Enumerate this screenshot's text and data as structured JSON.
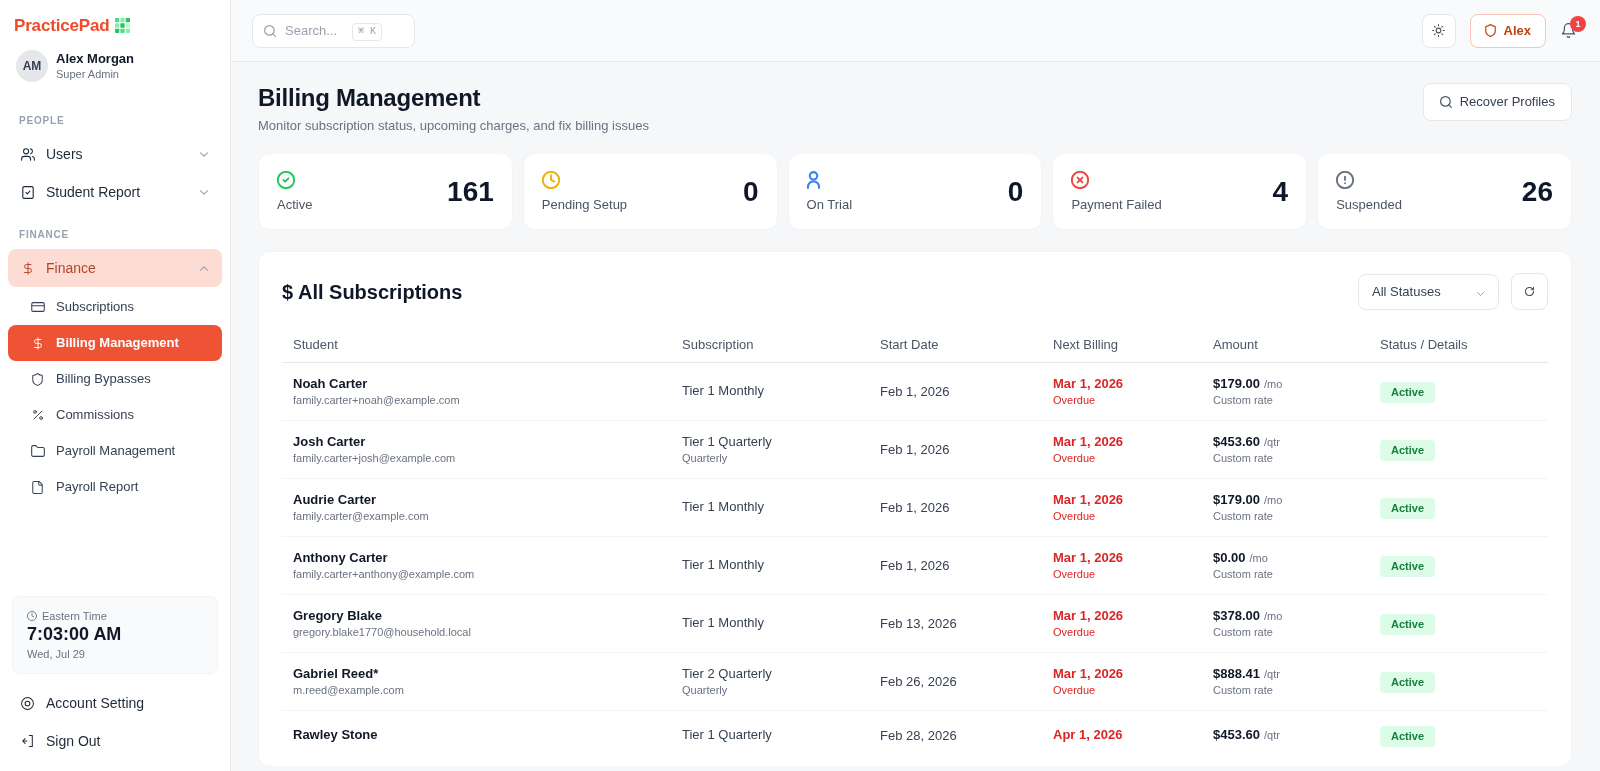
{
  "sidebar": {
    "logo": "PracticePad",
    "user": {
      "initials": "AM",
      "name": "Alex Morgan",
      "role": "Super Admin"
    },
    "sections": [
      {
        "heading": "PEOPLE",
        "items": [
          {
            "label": "Users",
            "selected": false,
            "expanded": false
          },
          {
            "label": "Student Report",
            "selected": false,
            "expanded": false
          }
        ]
      },
      {
        "heading": "FINANCE",
        "items": [
          {
            "label": "Finance",
            "selected": true,
            "expanded": true,
            "children": [
              {
                "label": "Subscriptions",
                "selected": false
              },
              {
                "label": "Billing Management",
                "selected": true
              },
              {
                "label": "Billing Bypasses",
                "selected": false
              },
              {
                "label": "Commissions",
                "selected": false
              },
              {
                "label": "Payroll Management",
                "selected": false
              },
              {
                "label": "Payroll Report",
                "selected": false
              }
            ]
          }
        ]
      }
    ],
    "clock": {
      "zone": "Eastern Time",
      "time": "7:03:00 AM",
      "date": "Wed, Jul 29"
    },
    "footer_items": [
      {
        "label": "Account Setting"
      },
      {
        "label": "Sign Out"
      }
    ]
  },
  "topbar": {
    "search": {
      "placeholder": "Search...",
      "shortcut": "⌘ K"
    },
    "account_button": "Alex",
    "notification_badge": "1"
  },
  "header": {
    "title": "Billing Management",
    "subtitle": "Monitor subscription status, upcoming charges, and fix billing issues",
    "action": "Recover Profiles"
  },
  "stats": [
    {
      "label": "Active",
      "value": "161",
      "color": "#22c55e"
    },
    {
      "label": "Pending Setup",
      "value": "0",
      "color": "#eab308"
    },
    {
      "label": "On Trial",
      "value": "0",
      "color": "#3b82f6"
    },
    {
      "label": "Payment Failed",
      "value": "4",
      "color": "#ef4444"
    },
    {
      "label": "Suspended",
      "value": "26",
      "color": "#6b7280"
    }
  ],
  "subscriptions": {
    "title": "$ All Subscriptions",
    "filter": "All Statuses",
    "table": {
      "columns": [
        "Student",
        "Subscription",
        "Start Date",
        "Next Billing",
        "Amount",
        "Status / Details"
      ],
      "rows": [
        {
          "student": "Noah Carter",
          "email": "family.carter+noah@example.com",
          "plan": "Tier 1 Monthly",
          "start_date": "Feb 1, 2026",
          "next_billing": "Mar 1, 2026",
          "billing_note": "Overdue",
          "amount": "$179.00",
          "period": "/mo",
          "rate_note": "Custom rate",
          "status": "Active"
        },
        {
          "student": "Josh Carter",
          "email": "family.carter+josh@example.com",
          "plan": "Tier 1 Quarterly",
          "plan_note": "Quarterly",
          "start_date": "Feb 1, 2026",
          "next_billing": "Mar 1, 2026",
          "billing_note": "Overdue",
          "amount": "$453.60",
          "period": "/qtr",
          "rate_note": "Custom rate",
          "status": "Active"
        },
        {
          "student": "Audrie Carter",
          "email": "family.carter@example.com",
          "plan": "Tier 1 Monthly",
          "start_date": "Feb 1, 2026",
          "next_billing": "Mar 1, 2026",
          "billing_note": "Overdue",
          "amount": "$179.00",
          "period": "/mo",
          "rate_note": "Custom rate",
          "status": "Active"
        },
        {
          "student": "Anthony Carter",
          "email": "family.carter+anthony@example.com",
          "plan": "Tier 1 Monthly",
          "start_date": "Feb 1, 2026",
          "next_billing": "Mar 1, 2026",
          "billing_note": "Overdue",
          "amount": "$0.00",
          "period": "/mo",
          "rate_note": "Custom rate",
          "status": "Active"
        },
        {
          "student": "Gregory Blake",
          "email": "gregory.blake1770@household.local",
          "plan": "Tier 1 Monthly",
          "start_date": "Feb 13, 2026",
          "next_billing": "Mar 1, 2026",
          "billing_note": "Overdue",
          "amount": "$378.00",
          "period": "/mo",
          "rate_note": "Custom rate",
          "status": "Active"
        },
        {
          "student": "Gabriel Reed*",
          "email": "m.reed@example.com",
          "plan": "Tier 2 Quarterly",
          "plan_note": "Quarterly",
          "start_date": "Feb 26, 2026",
          "next_billing": "Mar 1, 2026",
          "billing_note": "Overdue",
          "amount": "$888.41",
          "period": "/qtr",
          "rate_note": "Custom rate",
          "status": "Active"
        },
        {
          "student": "Rawley Stone",
          "plan": "Tier 1 Quarterly",
          "start_date": "Feb 28, 2026",
          "next_billing": "Apr 1, 2026",
          "amount": "$453.60",
          "period": "/qtr",
          "status": "Active"
        }
      ]
    }
  }
}
